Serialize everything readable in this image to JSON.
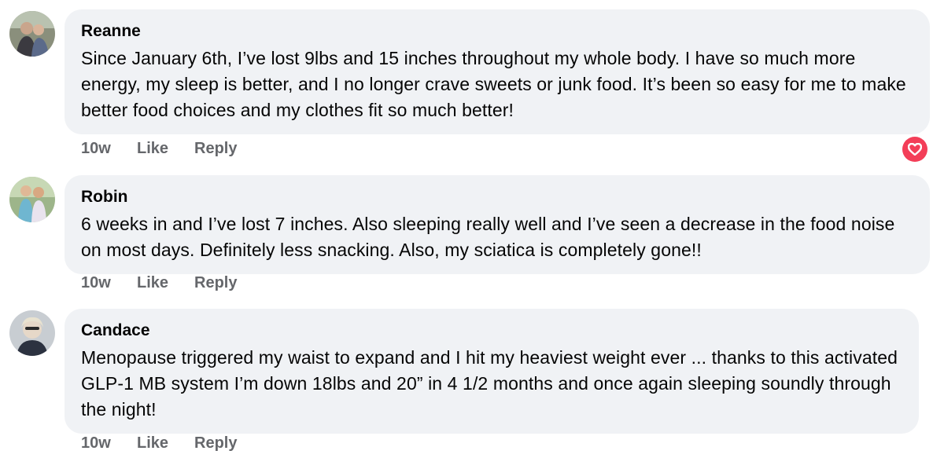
{
  "comments": [
    {
      "author": "Reanne",
      "text": "Since January 6th, I’ve lost 9lbs and 15 inches throughout my whole body. I have so much more energy, my sleep is better, and I no longer crave sweets or junk food. It’s been so easy for me to make better food choices and my clothes fit so much better!",
      "time": "10w",
      "like_label": "Like",
      "reply_label": "Reply",
      "reaction": "heart-reaction-icon"
    },
    {
      "author": "Robin",
      "text": "6 weeks in and I’ve lost 7 inches. Also sleeping really well and I’ve seen a decrease in the food noise on most days. Definitely less snacking. Also, my sciatica is completely gone!!",
      "time": "10w",
      "like_label": "Like",
      "reply_label": "Reply"
    },
    {
      "author": "Candace",
      "text": "Menopause triggered my waist to expand and I hit my heaviest weight ever ... thanks to this activated GLP-1 MB system I’m down 18lbs and 20” in 4 1/2 months and once again sleeping soundly through the night!",
      "time": "10w",
      "like_label": "Like",
      "reply_label": "Reply"
    }
  ],
  "colors": {
    "bubble": "#f0f2f5",
    "action_text": "#65676b",
    "heart_reaction": "#f33e58"
  }
}
